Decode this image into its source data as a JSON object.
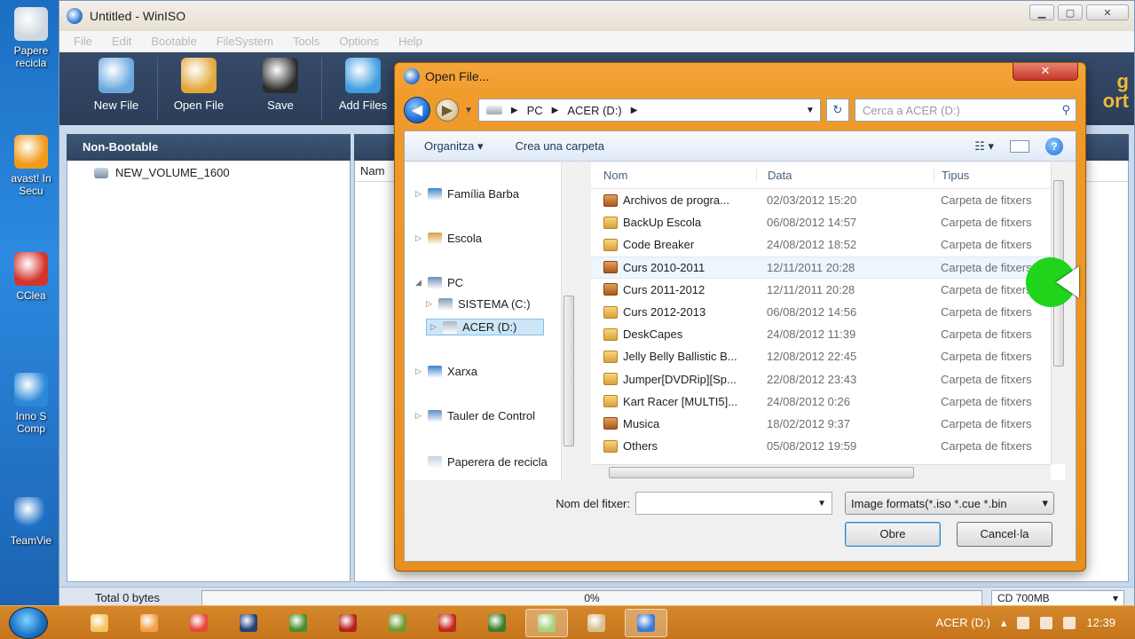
{
  "desktop": {
    "icons": [
      {
        "label": "Papere recicla",
        "color": "#cfd8e2"
      },
      {
        "label": "avast! In Secu",
        "color": "#f29a18"
      },
      {
        "label": "CClea",
        "color": "#d4342b"
      },
      {
        "label": "Inno S Comp",
        "color": "#2d89d8"
      },
      {
        "label": "TeamVie",
        "color": "#1d6fc4"
      }
    ]
  },
  "app": {
    "title": "Untitled - WinISO",
    "menu": [
      "File",
      "Edit",
      "Bootable",
      "FileSystem",
      "Tools",
      "Options",
      "Help"
    ],
    "toolbar": [
      {
        "label": "New File",
        "color": "#69a8de"
      },
      {
        "label": "Open File",
        "color": "#e3a638"
      },
      {
        "label": "Save",
        "color": "#2c2c2c"
      },
      {
        "label": "Add Files",
        "color": "#3d9de0"
      }
    ],
    "right_brand": [
      "g",
      "ort"
    ],
    "left_header": "Non-Bootable",
    "volume": "NEW_VOLUME_1600",
    "col_name": "Nam",
    "status_total": "Total 0 bytes",
    "progress_text": "0%",
    "progress_value": 0,
    "disc_type": "CD 700MB"
  },
  "dialog": {
    "title": "Open File...",
    "path": [
      "PC",
      "ACER (D:)"
    ],
    "search_placeholder": "Cerca a ACER (D:)",
    "organize": "Organitza",
    "new_folder": "Crea una carpeta",
    "nav_items": [
      {
        "label": "Família Barba",
        "color": "#3a87c9",
        "selected": false
      },
      {
        "label": "Escola",
        "color": "#d8a13c",
        "selected": false
      },
      {
        "label": "PC",
        "color": "#6a8fb7",
        "selected": false
      },
      {
        "label": "SISTEMA (C:)",
        "color": "#7f9cb8",
        "selected": false
      },
      {
        "label": "ACER (D:)",
        "color": "#a9b6c4",
        "selected": true
      },
      {
        "label": "Xarxa",
        "color": "#3a7fcf",
        "selected": false
      },
      {
        "label": "Tauler de Control",
        "color": "#5b8fc5",
        "selected": false
      },
      {
        "label": "Paperera de recicla",
        "color": "#c6d2df",
        "selected": false
      }
    ],
    "columns": [
      "Nom",
      "Data",
      "Tipus"
    ],
    "files": [
      {
        "name": "Archivos de progra...",
        "date": "02/03/2012 15:20",
        "type": "Carpeta de fitxers",
        "dark": true
      },
      {
        "name": "BackUp Escola",
        "date": "06/08/2012 14:57",
        "type": "Carpeta de fitxers",
        "dark": false
      },
      {
        "name": "Code Breaker",
        "date": "24/08/2012 18:52",
        "type": "Carpeta de fitxers",
        "dark": false
      },
      {
        "name": "Curs 2010-2011",
        "date": "12/11/2011 20:28",
        "type": "Carpeta de fitxers",
        "dark": true
      },
      {
        "name": "Curs 2011-2012",
        "date": "12/11/2011 20:28",
        "type": "Carpeta de fitxers",
        "dark": true
      },
      {
        "name": "Curs 2012-2013",
        "date": "06/08/2012 14:56",
        "type": "Carpeta de fitxers",
        "dark": false
      },
      {
        "name": "DeskCapes",
        "date": "24/08/2012 11:39",
        "type": "Carpeta de fitxers",
        "dark": false
      },
      {
        "name": "Jelly Belly Ballistic B...",
        "date": "12/08/2012 22:45",
        "type": "Carpeta de fitxers",
        "dark": false
      },
      {
        "name": "Jumper[DVDRip][Sp...",
        "date": "22/08/2012 23:43",
        "type": "Carpeta de fitxers",
        "dark": false
      },
      {
        "name": "Kart Racer [MULTI5]...",
        "date": "24/08/2012 0:26",
        "type": "Carpeta de fitxers",
        "dark": false
      },
      {
        "name": "Musica",
        "date": "18/02/2012 9:37",
        "type": "Carpeta de fitxers",
        "dark": true
      },
      {
        "name": "Others",
        "date": "05/08/2012 19:59",
        "type": "Carpeta de fitxers",
        "dark": false
      }
    ],
    "filename_label": "Nom del fitxer:",
    "filename_value": "",
    "filetype": "Image formats(*.iso *.cue *.bin",
    "open_button": "Obre",
    "cancel_button": "Cancel·la"
  },
  "taskbar": {
    "apps": [
      {
        "color": "#f2c864"
      },
      {
        "color": "#f1a24a"
      },
      {
        "color": "#e8463a"
      },
      {
        "color": "#263f7a"
      },
      {
        "color": "#4a8f2c"
      },
      {
        "color": "#b5221c"
      },
      {
        "color": "#6d9b2d"
      },
      {
        "color": "#c2261e"
      },
      {
        "color": "#3e7d2a"
      },
      {
        "color": "#a7d37d",
        "active": true
      },
      {
        "color": "#d9bf8c"
      },
      {
        "color": "#3a7bd5",
        "active": true
      }
    ],
    "drive": "ACER (D:)",
    "clock": "12:39"
  }
}
